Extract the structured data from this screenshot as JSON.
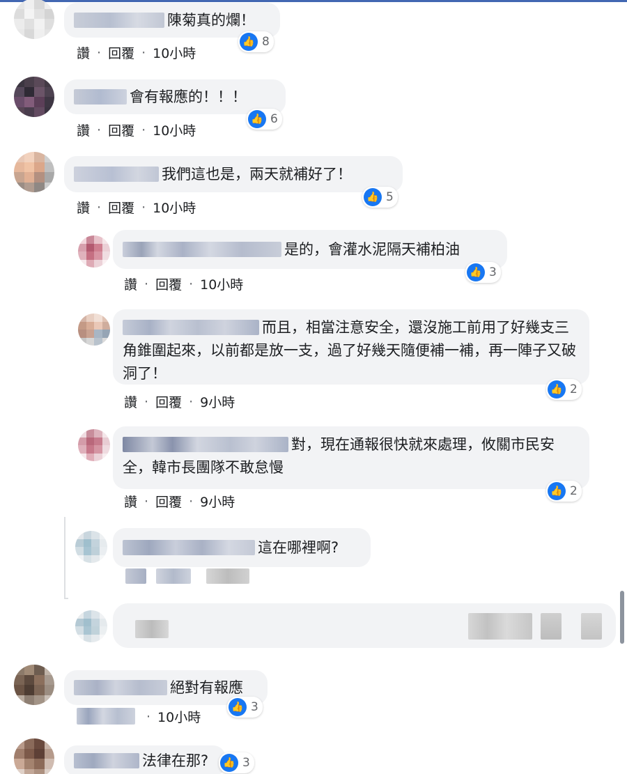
{
  "colors": {
    "facebook_blue": "#1877f2",
    "bubble_bg": "#f2f3f5",
    "meta_text": "#65676b"
  },
  "icons": {
    "like": "thumbs-up-icon"
  },
  "actions": {
    "like": "讚",
    "reply": "回覆",
    "separator": "·"
  },
  "comments": [
    {
      "text": "陳菊真的爛！",
      "reactions": "8",
      "time": "10小時"
    },
    {
      "text": "會有報應的！！！",
      "reactions": "6",
      "time": "10小時"
    },
    {
      "text": "我們這也是，兩天就補好了！",
      "reactions": "5",
      "time": "10小時"
    },
    {
      "text": "是的，會灌水泥隔天補柏油",
      "reactions": "3",
      "time": "10小時"
    },
    {
      "text": "而且，相當注意安全，還沒施工前用了好幾支三角錐圍起來，以前都是放一支，過了好幾天隨便補一補，再一陣子又破洞了！",
      "reactions": "2",
      "time": "9小時"
    },
    {
      "text": "對，現在通報很快就來處理，攸關市民安全，韓市長團隊不敢怠慢",
      "reactions": "2",
      "time": "9小時"
    },
    {
      "text": "這在哪裡啊?"
    },
    {
      "text": "絕對有報應",
      "reactions": "3",
      "time": "10小時"
    },
    {
      "text": "法律在那?",
      "reactions": "3"
    }
  ]
}
